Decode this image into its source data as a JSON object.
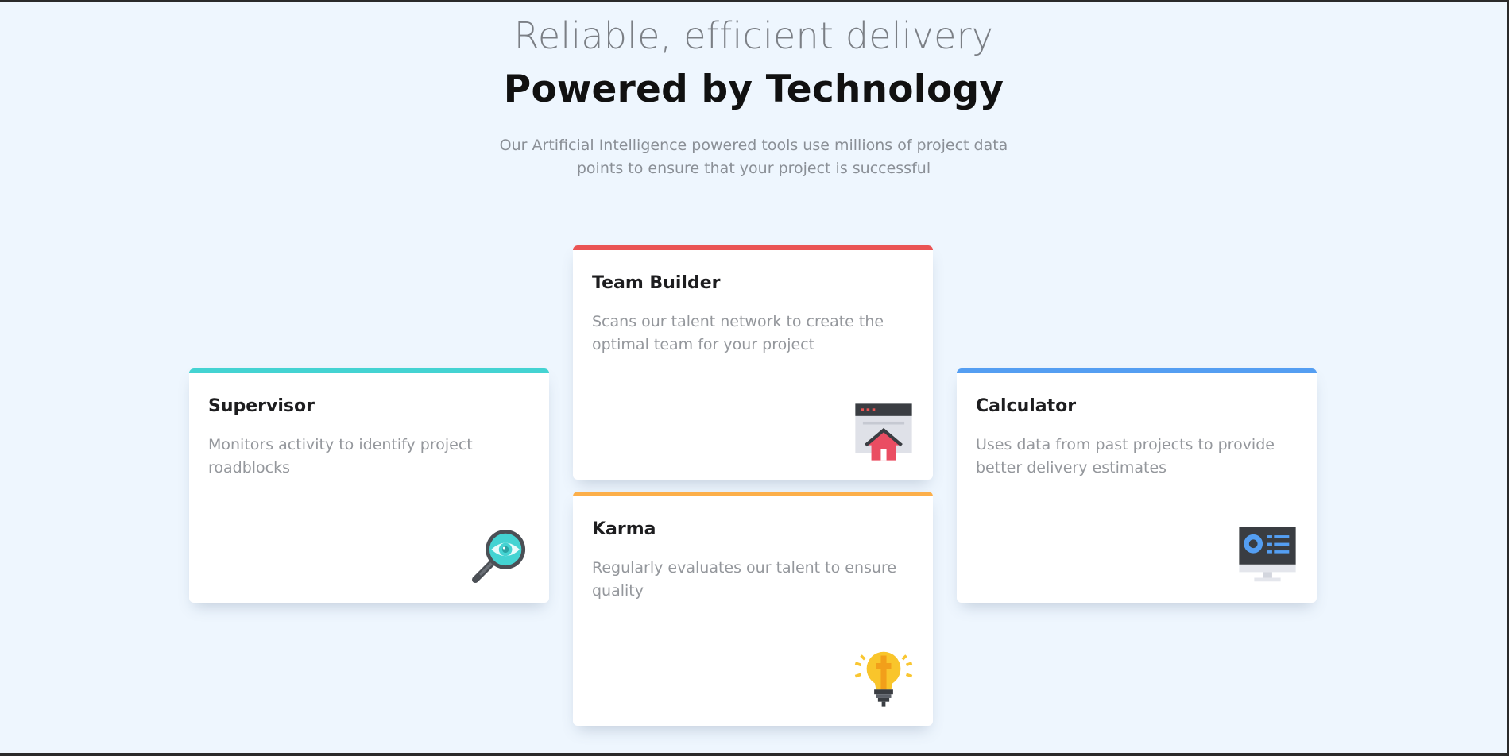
{
  "header": {
    "eyebrow": "Reliable, efficient delivery",
    "title": "Powered by Technology",
    "subtitle": "Our Artificial Intelligence powered tools use millions of project data points to ensure that your project is successful"
  },
  "cards": [
    {
      "title": "Supervisor",
      "text": "Monitors activity to identify project roadblocks",
      "accent": "#44d3d2",
      "icon": "magnifier-eye-icon"
    },
    {
      "title": "Team Builder",
      "text": "Scans our talent network to create the optimal team for your project",
      "accent": "#ea5454",
      "icon": "browser-house-icon"
    },
    {
      "title": "Karma",
      "text": "Regularly evaluates our talent to ensure quality",
      "accent": "#fcaf4a",
      "icon": "lightbulb-icon"
    },
    {
      "title": "Calculator",
      "text": "Uses data from past projects to provide better delivery estimates",
      "accent": "#549ef2",
      "icon": "monitor-dashboard-icon"
    }
  ],
  "colors": {
    "background": "#eef6fe",
    "heading": "#111111",
    "muted": "#8a8f96"
  }
}
